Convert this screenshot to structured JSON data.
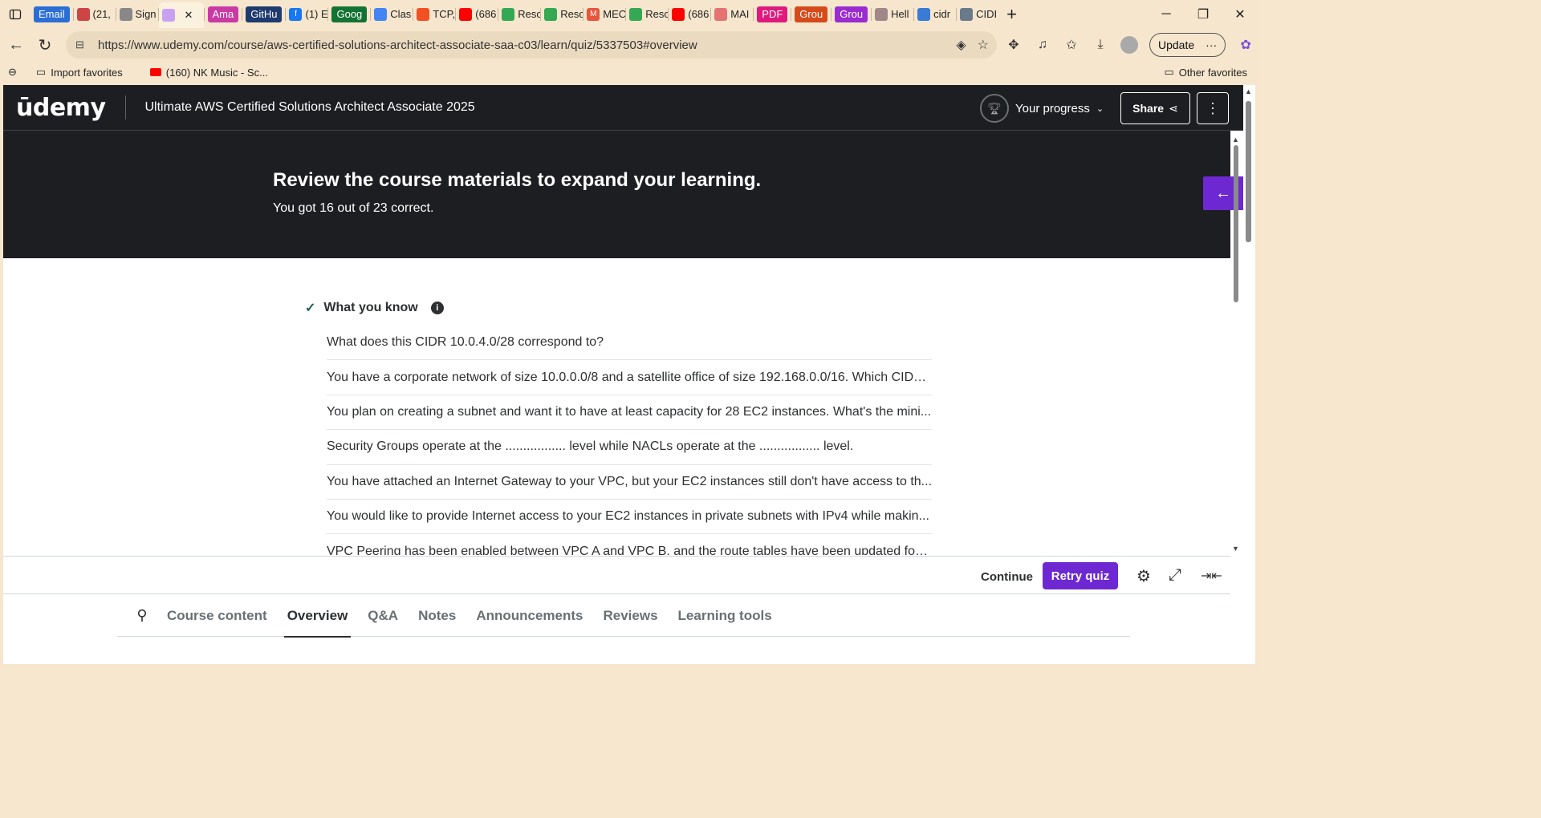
{
  "browser": {
    "tabs": [
      {
        "label": "Email",
        "color": "#2b6fd6",
        "pill": true
      },
      {
        "label": "(21,",
        "icon": "mail-icon"
      },
      {
        "label": "Sign",
        "icon": "sign-icon"
      },
      {
        "label": "",
        "icon": "udemy-tab-icon",
        "active": true
      },
      {
        "label": "Ama",
        "color": "#c93aa4",
        "pill": true
      },
      {
        "label": "GitHu",
        "color": "#1f3a6e",
        "pill": true
      },
      {
        "label": "(1) E",
        "icon": "facebook-icon"
      },
      {
        "label": "Goog",
        "color": "#137333",
        "pill": true
      },
      {
        "label": "Clas",
        "icon": "docs-icon"
      },
      {
        "label": "TCP,",
        "icon": "windows-icon"
      },
      {
        "label": "(686",
        "icon": "youtube-icon"
      },
      {
        "label": "Reso",
        "icon": "drive-icon"
      },
      {
        "label": "Reso",
        "icon": "drive-icon"
      },
      {
        "label": "MEC",
        "icon": "m-icon"
      },
      {
        "label": "Reso",
        "icon": "drive-icon"
      },
      {
        "label": "(686",
        "icon": "youtube-icon"
      },
      {
        "label": "MAI",
        "icon": "image-icon"
      },
      {
        "label": "PDF",
        "color": "#e0197d",
        "pill": true
      },
      {
        "label": "Grou",
        "color": "#d64a1a",
        "pill": true
      },
      {
        "label": "Grou",
        "color": "#9b2bd0",
        "pill": true
      },
      {
        "label": "Hell",
        "icon": "hello-icon"
      },
      {
        "label": "cidr",
        "icon": "search-icon"
      },
      {
        "label": "CIDI",
        "icon": "cidr-icon"
      }
    ],
    "close_tab": "✕",
    "new_tab": "+",
    "url": "https://www.udemy.com/course/aws-certified-solutions-architect-associate-saa-c03/learn/quiz/5337503#overview",
    "update_label": "Update",
    "favorites": {
      "import": "Import favorites",
      "nk_music": "(160) NK Music - Sc...",
      "other": "Other favorites"
    }
  },
  "udemy": {
    "logo": "ūdemy",
    "course_title": "Ultimate AWS Certified Solutions Architect Associate 2025",
    "progress_label": "Your progress",
    "share_label": "Share"
  },
  "quiz": {
    "heading": "Review the course materials to expand your learning.",
    "score_text": "You got 16 out of 23 correct.",
    "section_title": "What you know",
    "questions": [
      "What does this CIDR 10.0.4.0/28 correspond to?",
      "You have a corporate network of size 10.0.0.0/8 and a satellite office of size 192.168.0.0/16. Which CIDR...",
      "You plan on creating a subnet and want it to have at least capacity for 28 EC2 instances. What's the mini...",
      "Security Groups operate at the ................. level while NACLs operate at the ................. level.",
      "You have attached an Internet Gateway to your VPC, but your EC2 instances still don't have access to th...",
      "You would like to provide Internet access to your EC2 instances in private subnets with IPv4 while makin...",
      "VPC Peering has been enabled between VPC A and VPC B, and the route tables have been updated for ..."
    ],
    "continue_label": "Continue",
    "retry_label": "Retry quiz"
  },
  "course_tabs": {
    "items": [
      "Course content",
      "Overview",
      "Q&A",
      "Notes",
      "Announcements",
      "Reviews",
      "Learning tools"
    ],
    "active_index": 1
  }
}
